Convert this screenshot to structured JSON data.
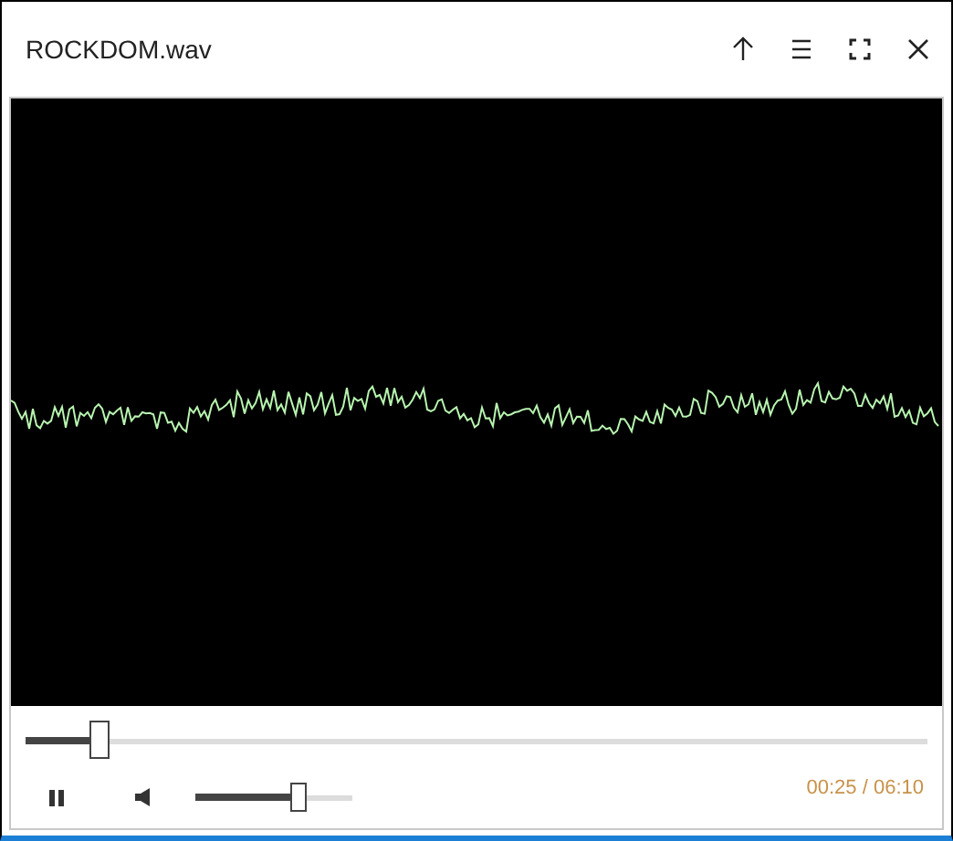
{
  "window": {
    "title": "ROCKDOM.wav"
  },
  "player": {
    "seek": {
      "level": 0.08
    },
    "playing": true,
    "muted": false,
    "volume": {
      "level": 0.65
    },
    "time": "00:25 / 06:10"
  }
}
